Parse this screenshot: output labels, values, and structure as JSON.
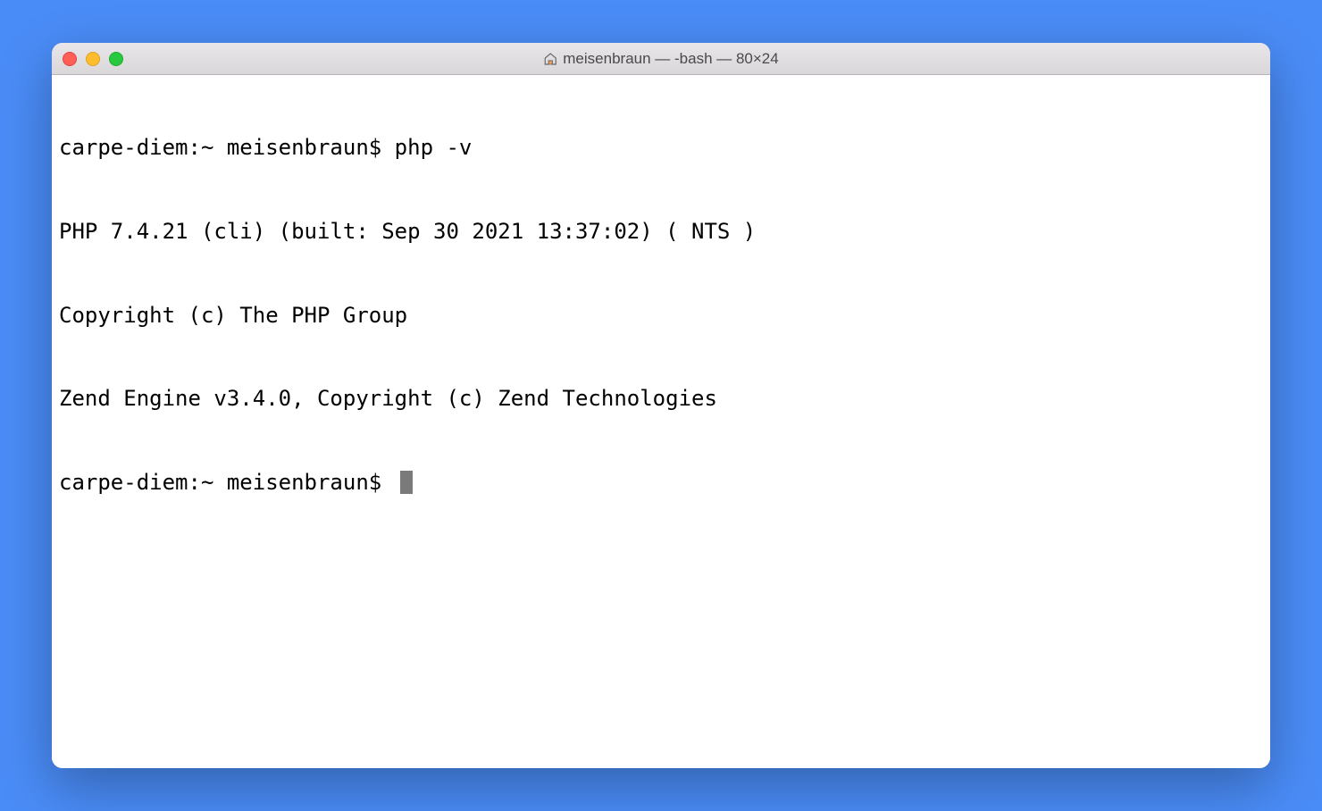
{
  "titlebar": {
    "title": "meisenbraun — -bash — 80×24"
  },
  "terminal": {
    "lines": [
      "carpe-diem:~ meisenbraun$ php -v",
      "PHP 7.4.21 (cli) (built: Sep 30 2021 13:37:02) ( NTS )",
      "Copyright (c) The PHP Group",
      "Zend Engine v3.4.0, Copyright (c) Zend Technologies"
    ],
    "prompt": "carpe-diem:~ meisenbraun$ "
  }
}
